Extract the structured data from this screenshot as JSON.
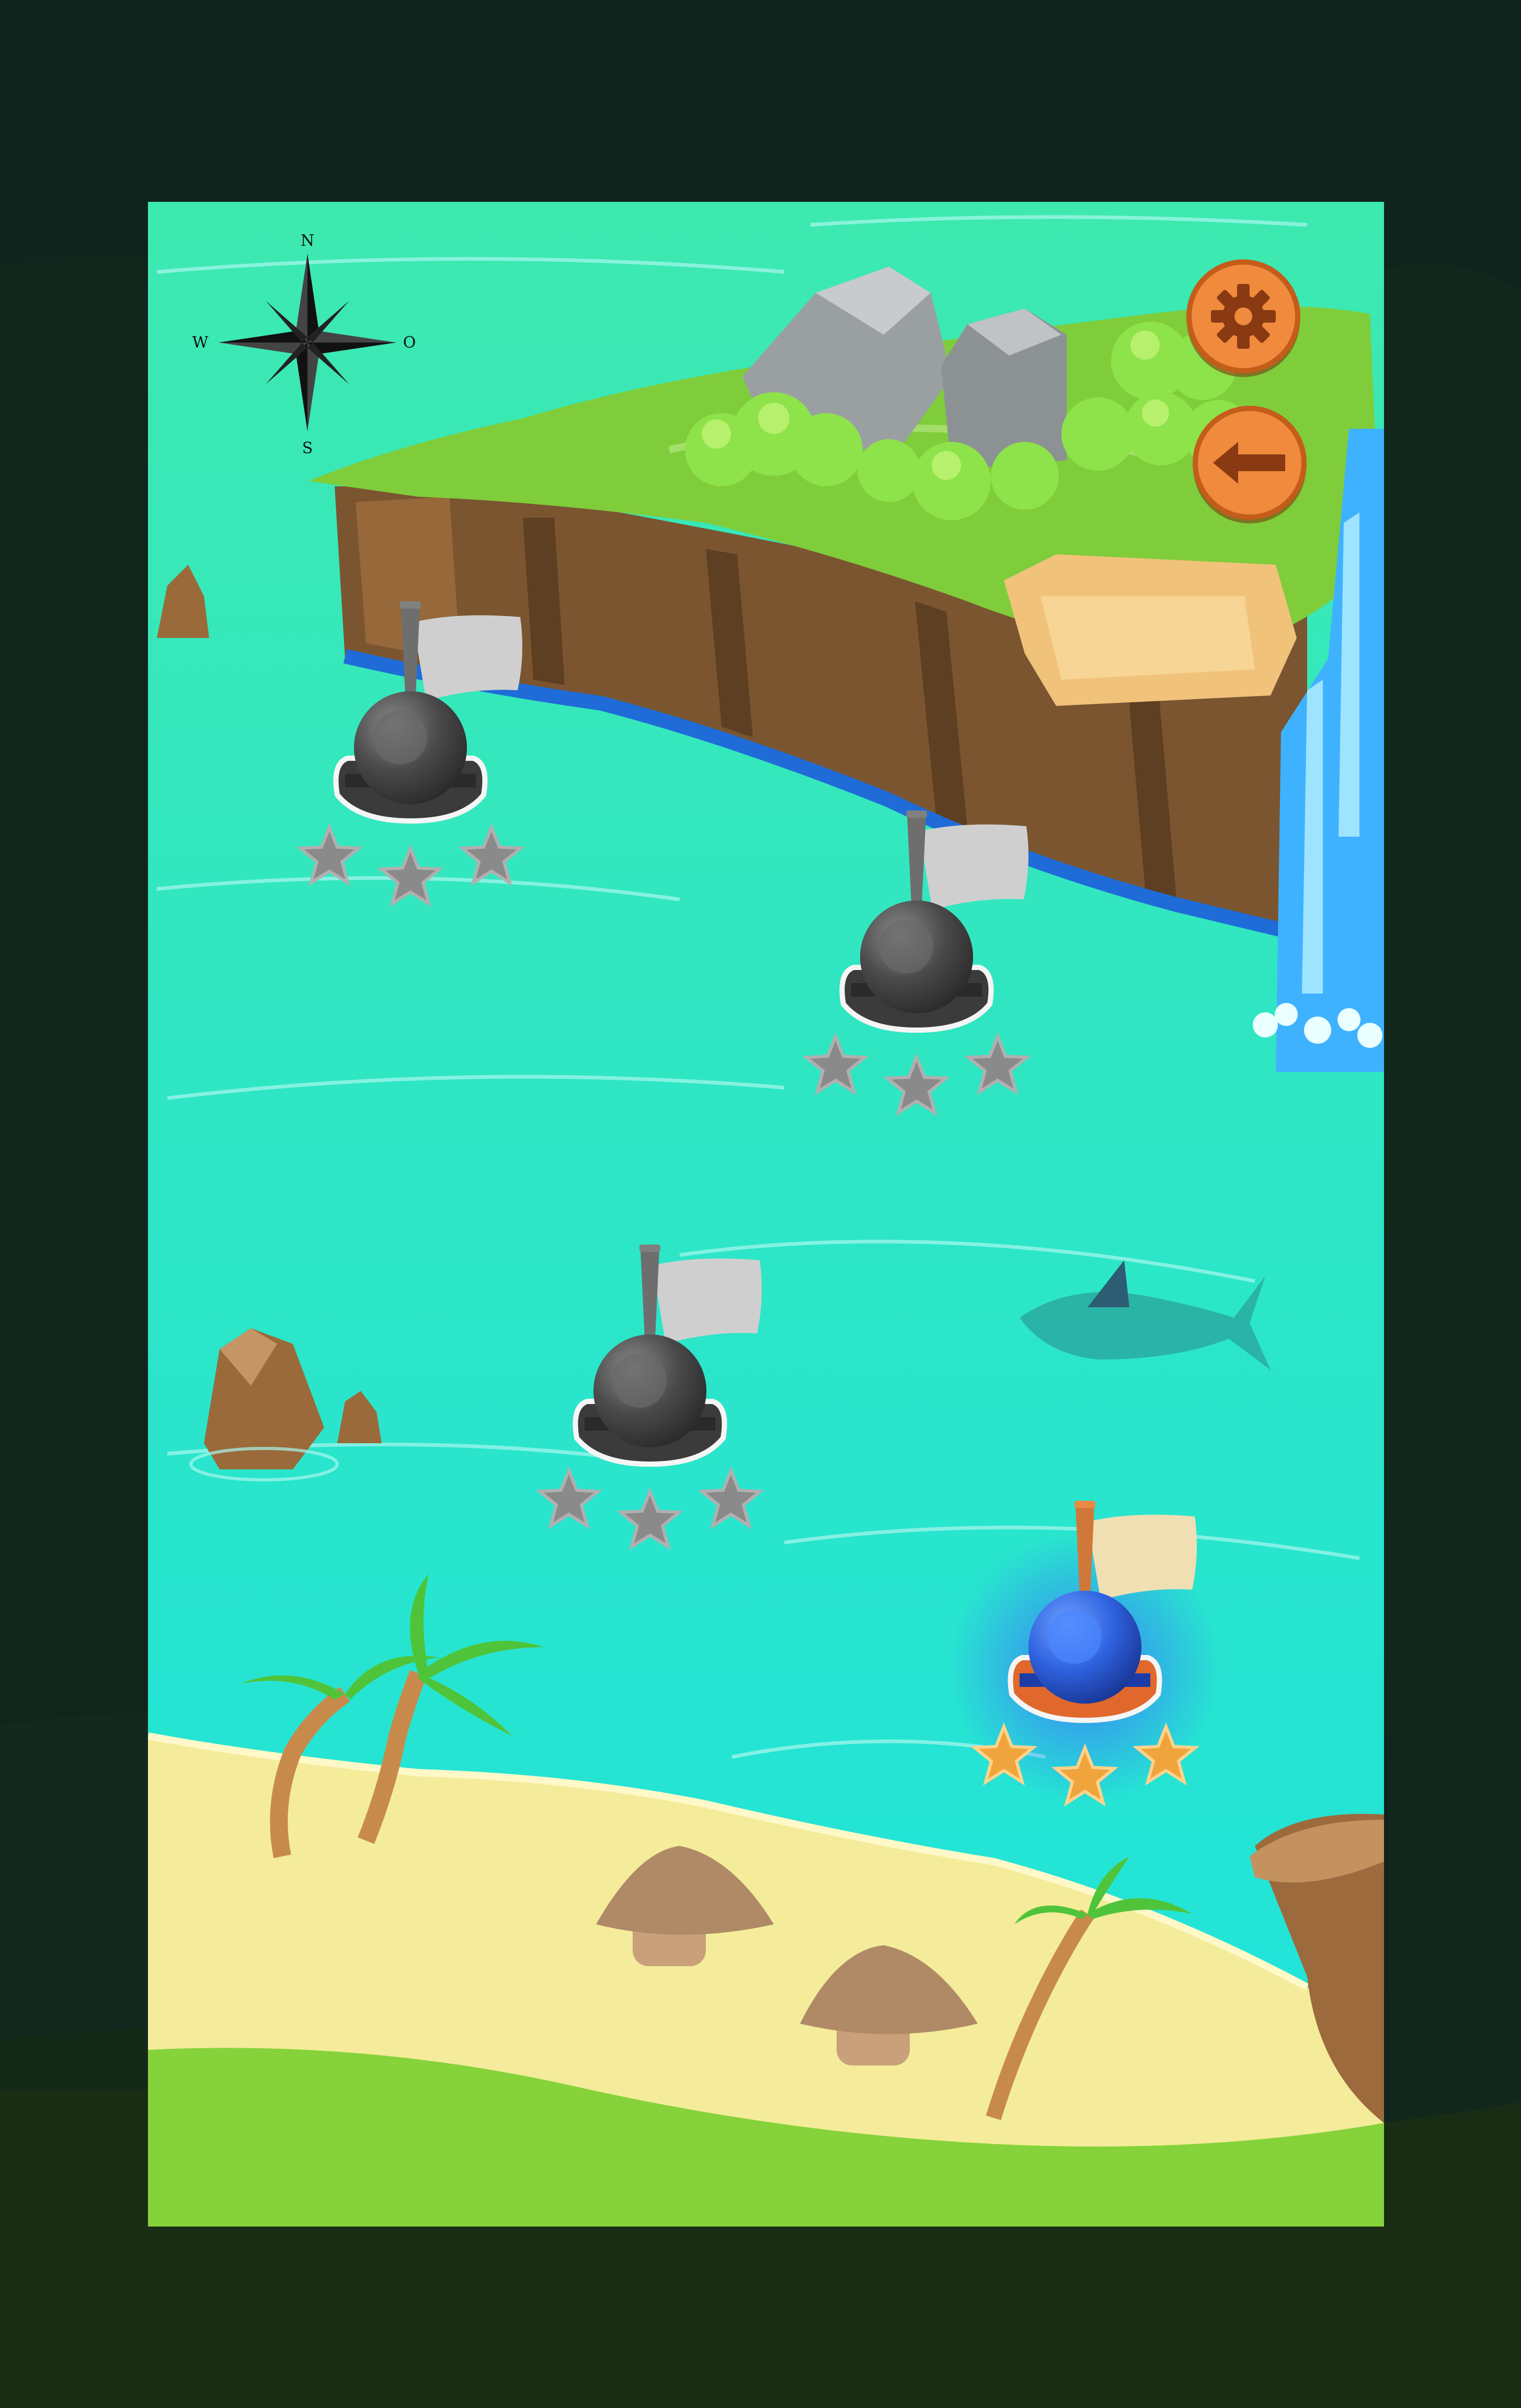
{
  "compass": {
    "north": "N",
    "south": "S",
    "west": "W",
    "east": "O"
  },
  "buttons": {
    "settings_icon": "gear-icon",
    "back_icon": "arrow-left-icon"
  },
  "levels": [
    {
      "id": 1,
      "status": "locked",
      "stars_earned": 0,
      "stars_total": 3,
      "flag": "grey"
    },
    {
      "id": 2,
      "status": "locked",
      "stars_earned": 0,
      "stars_total": 3,
      "flag": "grey"
    },
    {
      "id": 3,
      "status": "locked",
      "stars_earned": 0,
      "stars_total": 3,
      "flag": "grey"
    },
    {
      "id": 4,
      "status": "current",
      "stars_earned": 3,
      "stars_total": 3,
      "flag": "sand"
    }
  ],
  "colors": {
    "frame": "#0f241c",
    "water": "#27e6d2",
    "sand": "#f4ec9a",
    "grass": "#8fd23c",
    "button_orange": "#f08a3c",
    "star_gold": "#f0a43c",
    "star_grey": "#8a8a8a",
    "boat_active": "#2f6fe0",
    "boat_locked": "#454545"
  }
}
